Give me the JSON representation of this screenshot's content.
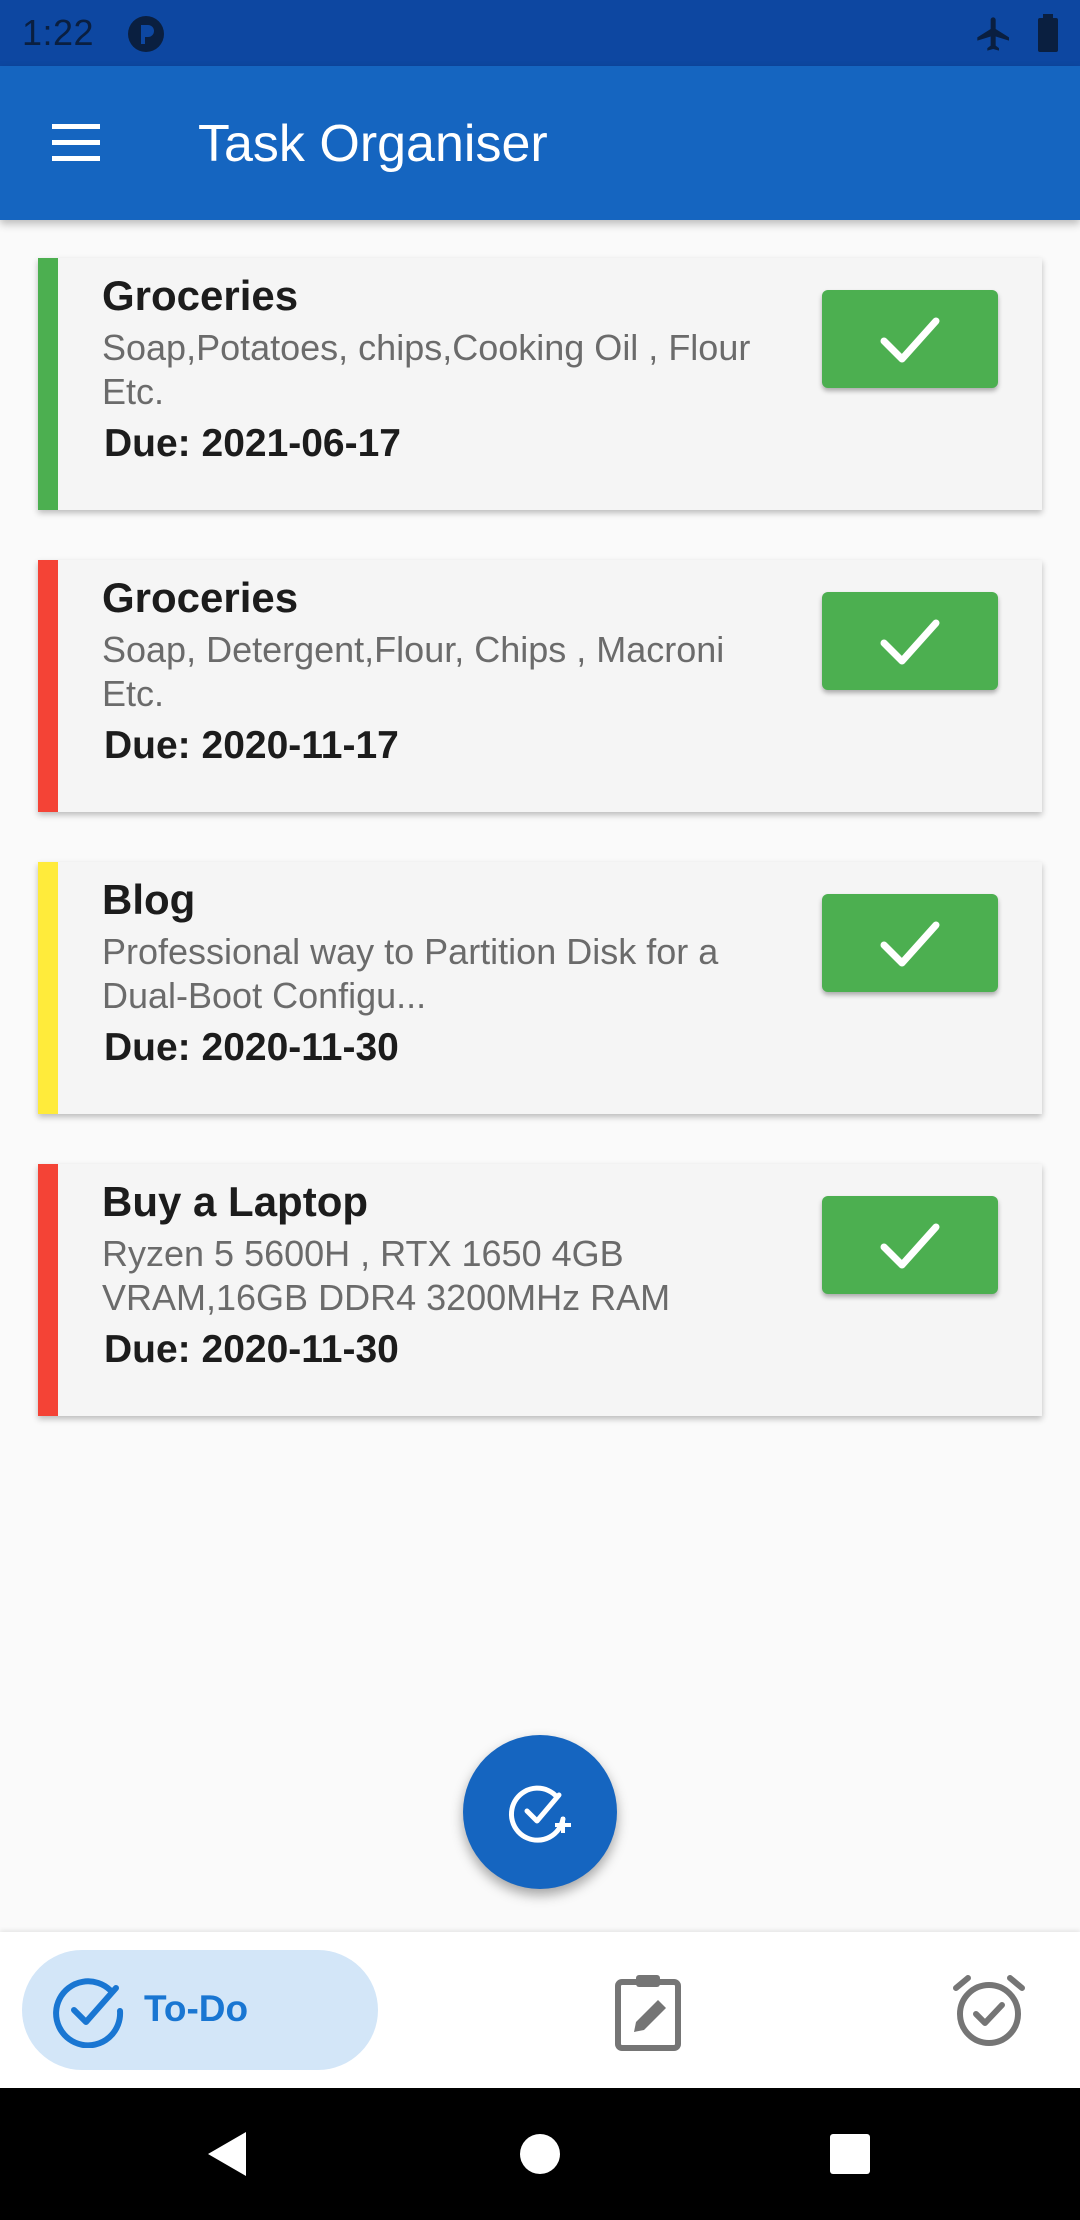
{
  "status_bar": {
    "time": "1:22"
  },
  "app_bar": {
    "title": "Task Organiser"
  },
  "tasks": [
    {
      "title": "Groceries",
      "description": "Soap,Potatoes, chips,Cooking Oil , Flour Etc.",
      "due": "Due: 2021-06-17",
      "priority_color": "#4caf50"
    },
    {
      "title": "Groceries",
      "description": "Soap, Detergent,Flour, Chips , Macroni Etc.",
      "due": "Due: 2020-11-17",
      "priority_color": "#f44336"
    },
    {
      "title": "Blog",
      "description": "Professional way to Partition Disk for a Dual-Boot Configu...",
      "due": "Due: 2020-11-30",
      "priority_color": "#ffeb3b"
    },
    {
      "title": "Buy a Laptop",
      "description": "Ryzen 5 5600H , RTX 1650 4GB VRAM,16GB DDR4 3200MHz RAM",
      "due": "Due: 2020-11-30",
      "priority_color": "#f44336"
    }
  ],
  "bottom_nav": {
    "todo_label": "To-Do"
  },
  "icons": {
    "menu": "menu-icon",
    "done": "check-icon",
    "fab": "add-task-icon",
    "todo": "check-circle-icon",
    "notes": "edit-clipboard-icon",
    "alarm": "alarm-check-icon"
  },
  "colors": {
    "primary": "#1565c0",
    "status_bar": "#0d47a1",
    "done_button": "#4caf50",
    "nav_selected_bg": "#d3e6f8"
  }
}
